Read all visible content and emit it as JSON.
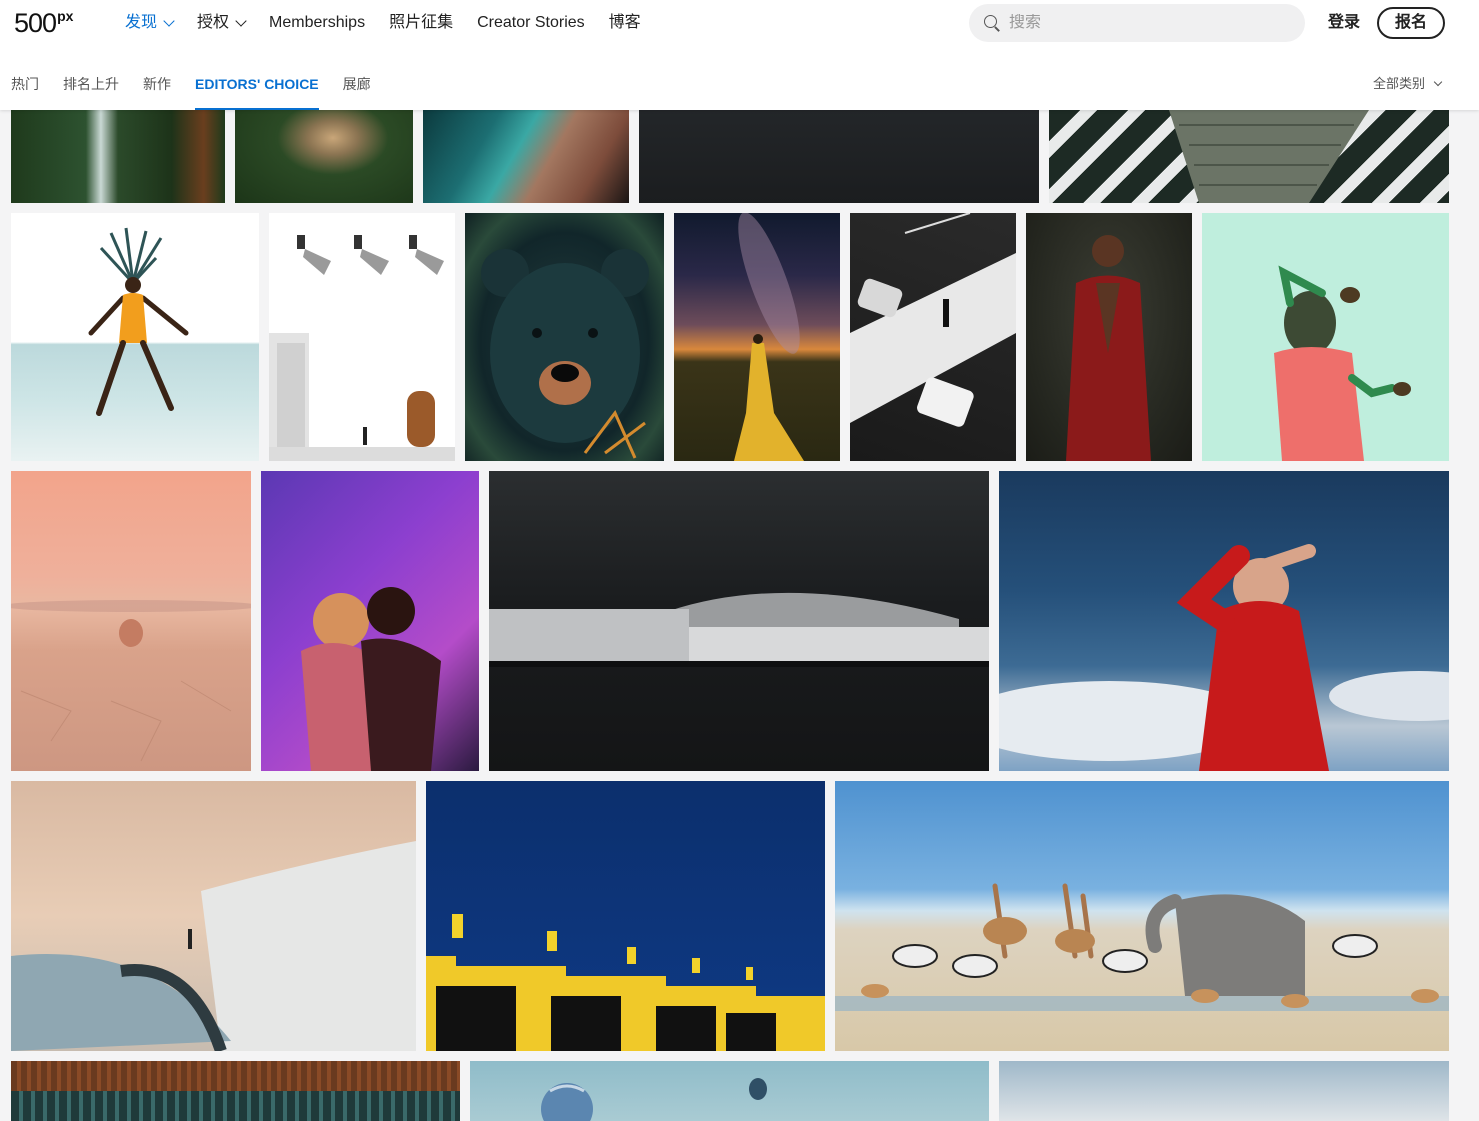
{
  "header": {
    "logo_big": "500",
    "logo_small": "px",
    "nav": [
      {
        "label": "发现",
        "dropdown": true,
        "active": true
      },
      {
        "label": "授权",
        "dropdown": true,
        "active": false
      },
      {
        "label": "Memberships",
        "dropdown": false,
        "active": false
      },
      {
        "label": "照片征集",
        "dropdown": false,
        "active": false
      },
      {
        "label": "Creator Stories",
        "dropdown": false,
        "active": false
      },
      {
        "label": "博客",
        "dropdown": false,
        "active": false
      }
    ],
    "search": {
      "placeholder": "搜索",
      "value": ""
    },
    "login_label": "登录",
    "signup_label": "报名"
  },
  "subnav": {
    "tabs": [
      {
        "label": "热门",
        "active": false
      },
      {
        "label": "排名上升",
        "active": false
      },
      {
        "label": "新作",
        "active": false
      },
      {
        "label": "EDITORS' CHOICE",
        "active": true
      },
      {
        "label": "展廊",
        "active": false
      }
    ],
    "category_label": "全部类别"
  },
  "colors": {
    "accent": "#0870d1",
    "background": "#f4f4f5"
  }
}
